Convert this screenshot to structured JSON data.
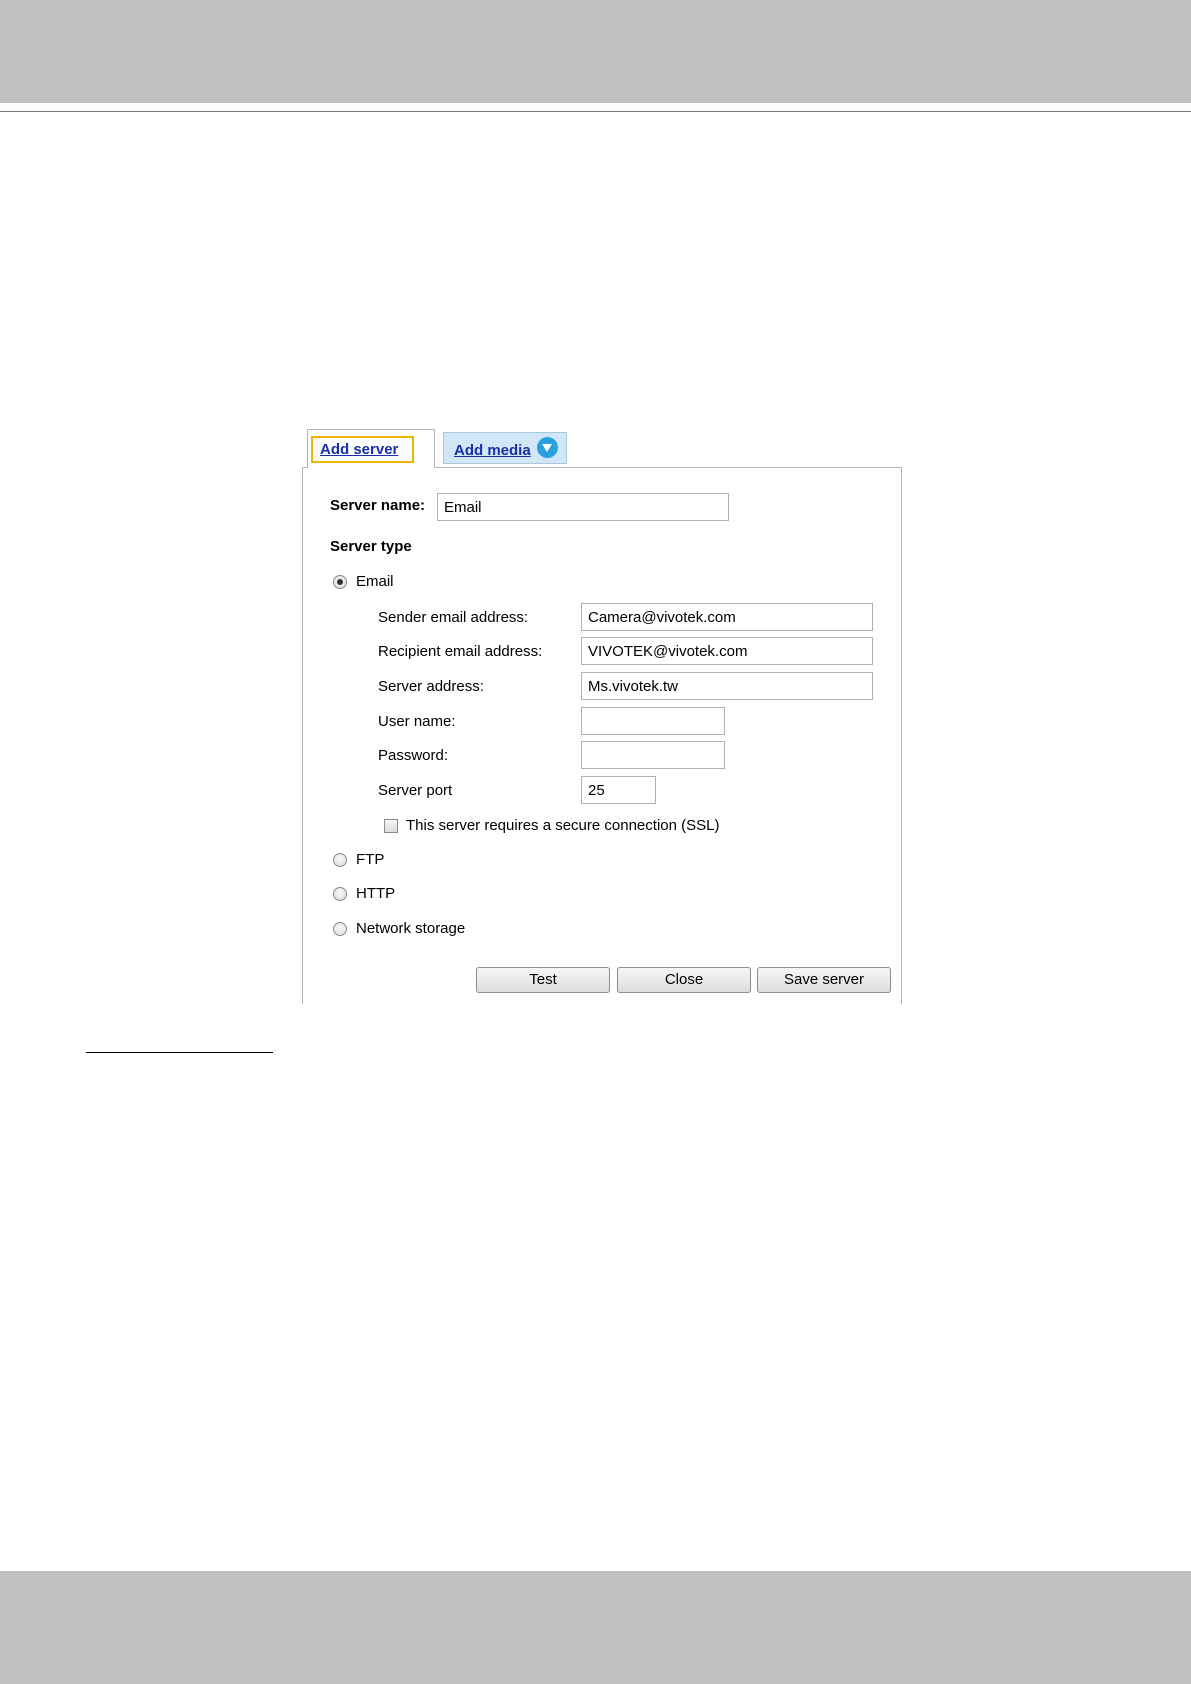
{
  "tabs": {
    "add_server": "Add server",
    "add_media": "Add media",
    "add_media_icon": "chevron-down-circle-icon"
  },
  "form": {
    "server_name_label": "Server name:",
    "server_name_value": "Email",
    "server_type_label": "Server type",
    "options": {
      "email": "Email",
      "ftp": "FTP",
      "http": "HTTP",
      "network_storage": "Network storage"
    },
    "selected_option": "Email",
    "email": {
      "sender_label": "Sender email address:",
      "sender_value": "Camera@vivotek.com",
      "recipient_label": "Recipient email address:",
      "recipient_value": "VIVOTEK@vivotek.com",
      "server_address_label": "Server address:",
      "server_address_value": "Ms.vivotek.tw",
      "user_name_label": "User name:",
      "user_name_value": "",
      "password_label": "Password:",
      "password_value": "",
      "server_port_label": "Server port",
      "server_port_value": "25",
      "ssl_label": "This server requires a secure connection (SSL)",
      "ssl_checked": false
    }
  },
  "buttons": {
    "test": "Test",
    "close": "Close",
    "save_server": "Save server"
  },
  "colors": {
    "link": "#1a2fa8",
    "highlight": "#f0b400",
    "media_tab_bg": "#cfe7f6",
    "icon_blue": "#2aa0df",
    "band_gray": "#c0c0c0"
  }
}
